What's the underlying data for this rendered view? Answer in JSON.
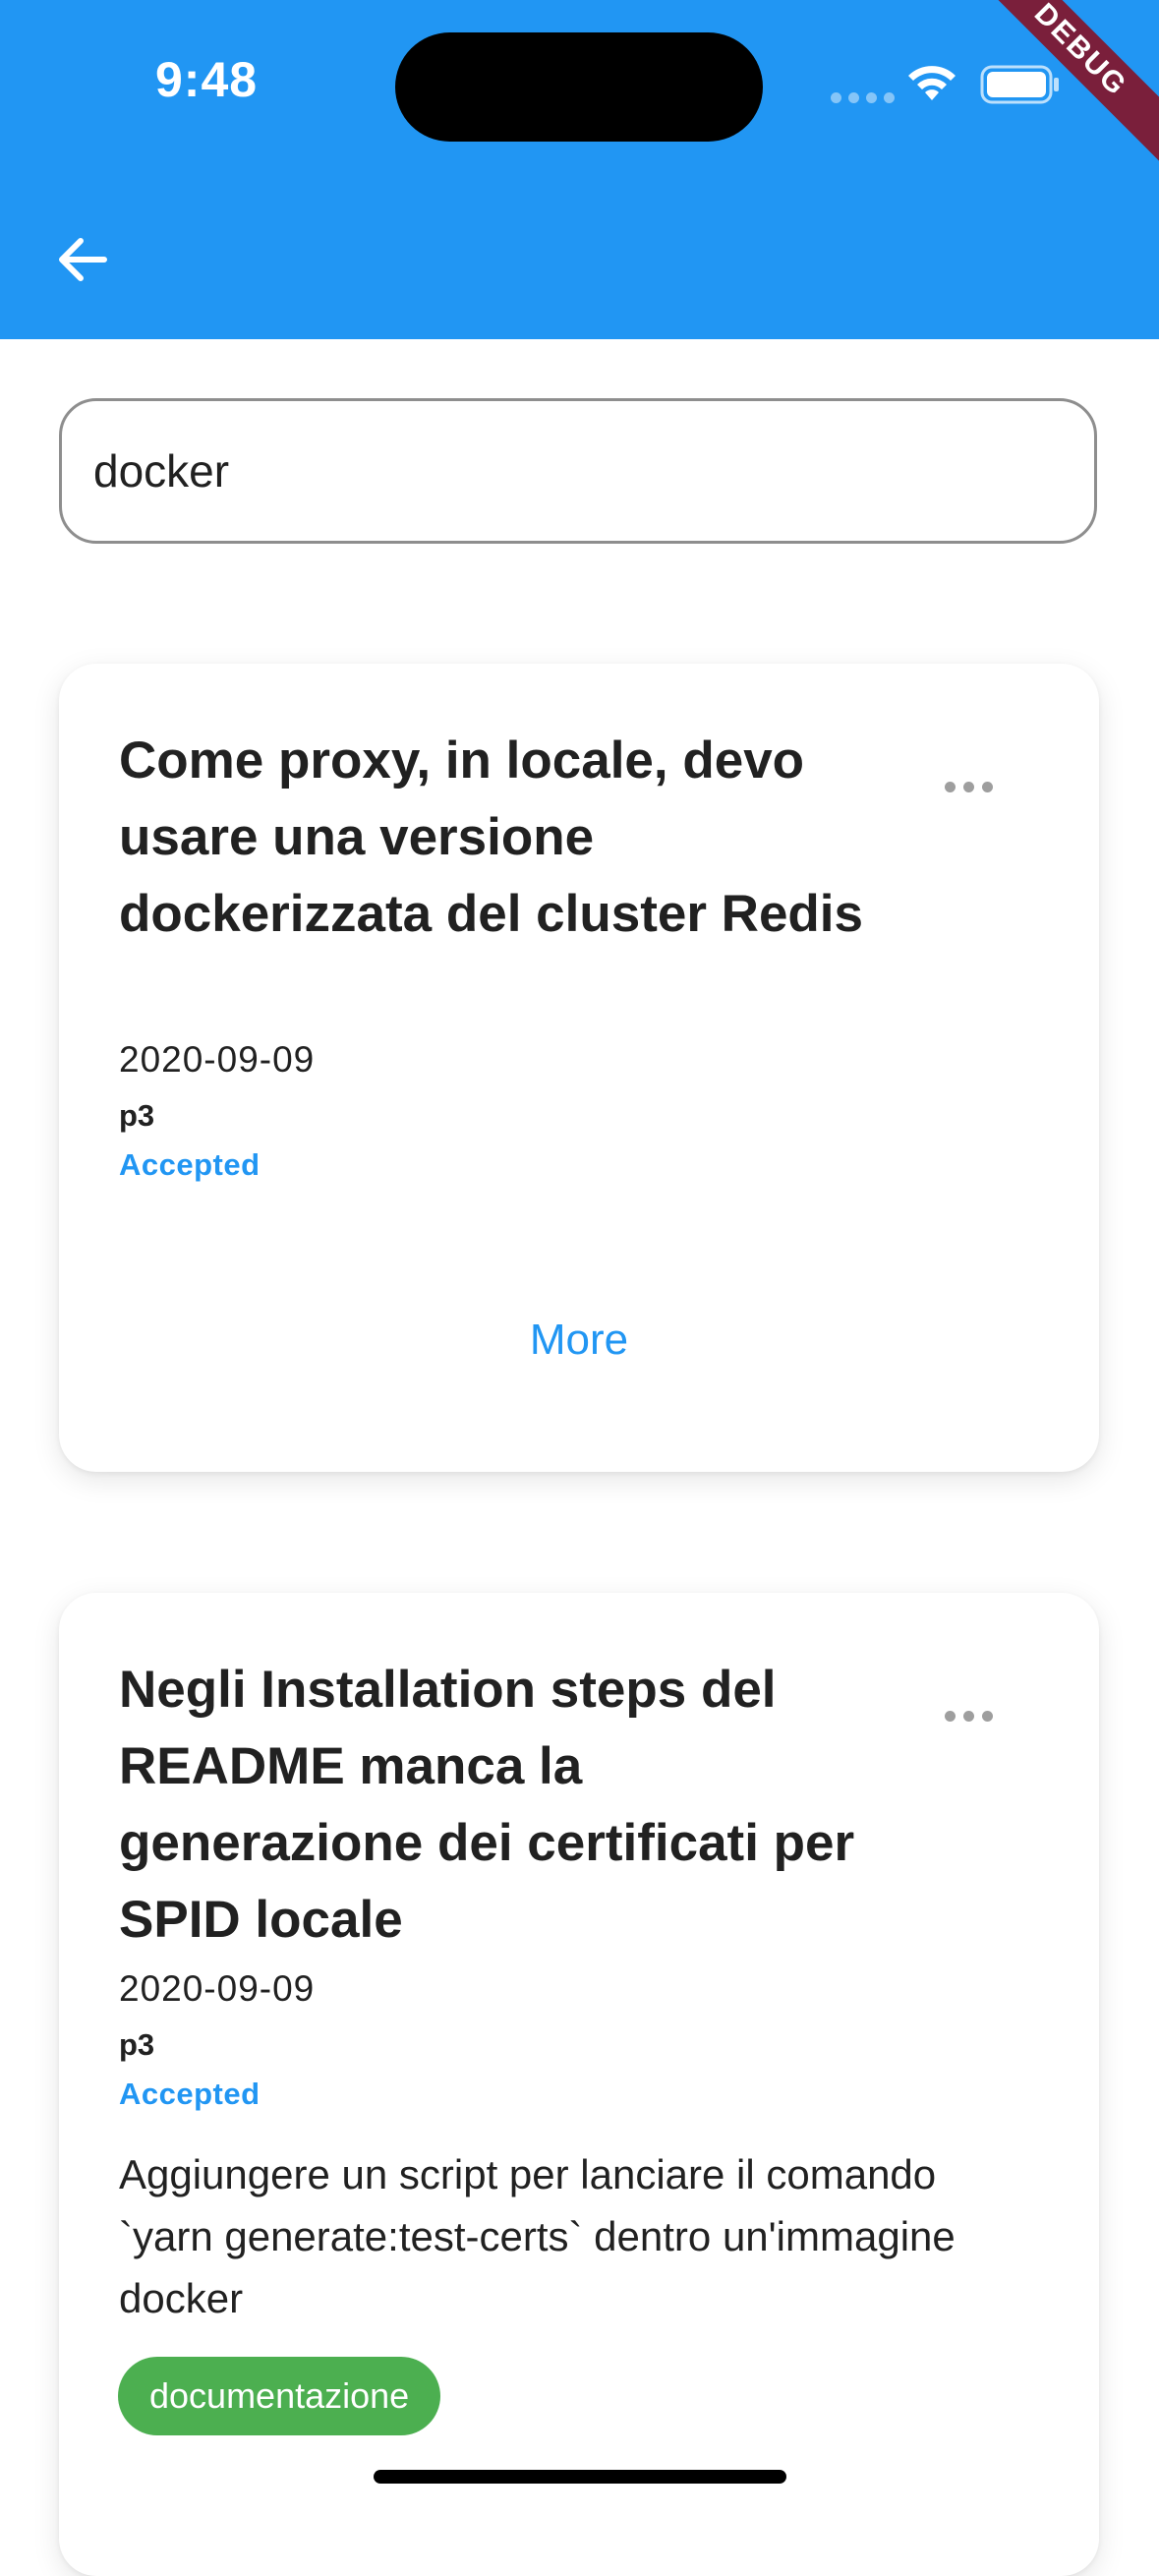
{
  "status_bar": {
    "time": "9:48",
    "debug_label": "DEBUG"
  },
  "search": {
    "value": "docker"
  },
  "cards": [
    {
      "title": "Come proxy, in locale, devo usare una versione dockerizzata del cluster Redis",
      "date": "2020-09-09",
      "priority": "p3",
      "status": "Accepted",
      "more_label": "More"
    },
    {
      "title": "Negli Installation steps del README manca la generazione dei certificati per SPID locale",
      "date": "2020-09-09",
      "priority": "p3",
      "status": "Accepted",
      "description": "Aggiungere un script per lanciare il comando `yarn generate:test-certs` dentro un'immagine docker",
      "tag": "documentazione"
    }
  ],
  "colors": {
    "app_bar": "#2196F3",
    "accent": "#2196F3",
    "tag": "#4CAF50",
    "debug": "#7a1f3b"
  }
}
